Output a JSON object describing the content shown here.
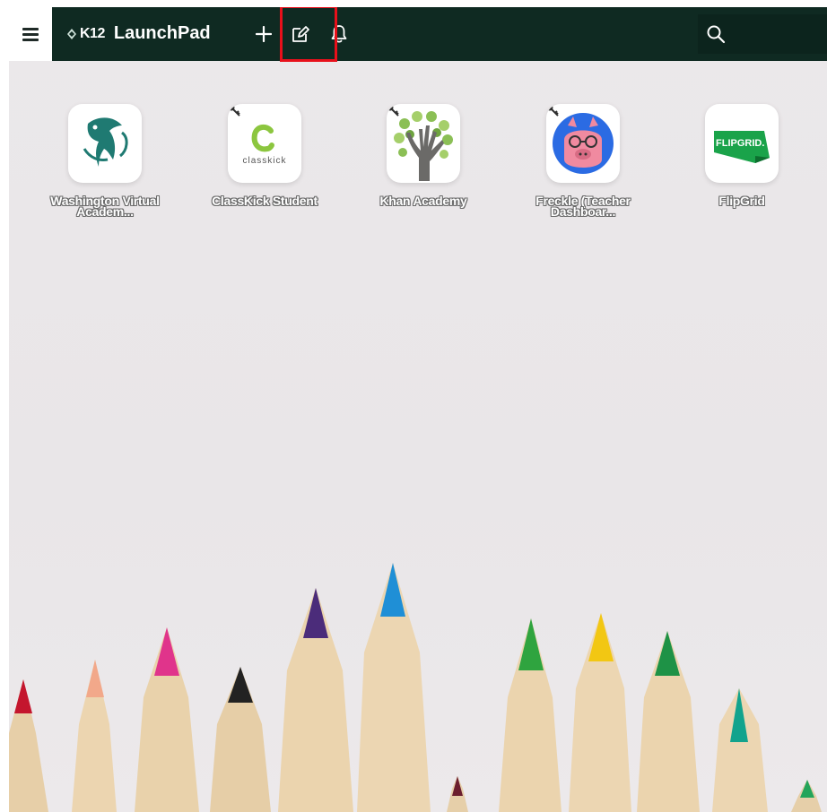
{
  "header": {
    "brand": "K12",
    "app_title": "LaunchPad",
    "menu_icon": "hamburger-menu-icon",
    "actions": [
      {
        "name": "add",
        "icon": "plus-icon"
      },
      {
        "name": "edit",
        "icon": "edit-pencil-icon"
      },
      {
        "name": "notifications",
        "icon": "bell-icon"
      }
    ],
    "search_icon": "search-icon"
  },
  "apps": [
    {
      "label_line1": "Washington Virtual",
      "label_line2": "Academ...",
      "icon": "orca-logo-icon"
    },
    {
      "label_line1": "ClassKick Student",
      "label_line2": "",
      "icon": "classkick-logo-icon",
      "icon_text": "classkick"
    },
    {
      "label_line1": "Khan Academy",
      "label_line2": "",
      "icon": "hand-tree-logo-icon"
    },
    {
      "label_line1": "Freckle (Teacher",
      "label_line2": "Dashboar...",
      "icon": "pig-logo-icon"
    },
    {
      "label_line1": "FlipGrid",
      "label_line2": "",
      "icon": "flipgrid-logo-icon",
      "icon_text": "FLIPGRID."
    }
  ],
  "colors": {
    "topbar": "#0f2a22",
    "highlight": "#e8101b",
    "background": "#ebe8ea"
  }
}
